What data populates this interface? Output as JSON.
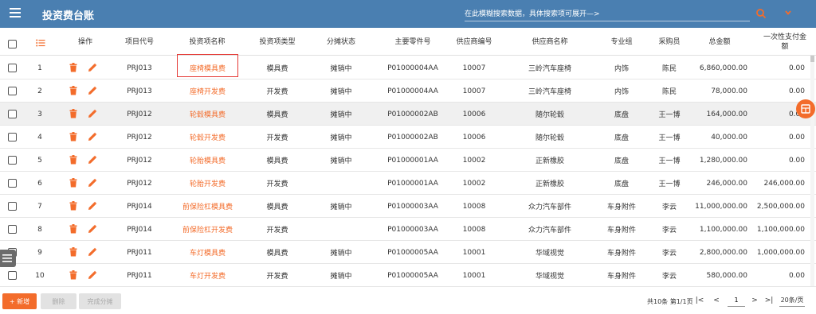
{
  "header": {
    "title": "投资费台账",
    "search_placeholder": "在此模糊搜索数据，具体搜索项可展开—>",
    "colors": {
      "bar": "#4a7fb1",
      "accent": "#f36c2b"
    },
    "icons": [
      "menu-icon",
      "search-icon",
      "chevron-down-icon"
    ]
  },
  "columns": {
    "operation": "操作",
    "project_code": "项目代号",
    "item_name": "投资项名称",
    "item_type": "投资项类型",
    "share_status": "分摊状态",
    "part_no": "主要零件号",
    "supplier_code": "供应商编号",
    "supplier_name": "供应商名称",
    "group": "专业组",
    "buyer": "采购员",
    "total": "总金额",
    "lump_sum": "一次性支付金额"
  },
  "rows": [
    {
      "no": "1",
      "project": "PRJ013",
      "name": "座椅模具费",
      "type": "模具费",
      "status": "摊销中",
      "part": "P01000004AA",
      "supplier_code": "10007",
      "supplier": "三岭汽车座椅",
      "group": "内饰",
      "buyer": "陈民",
      "total": "6,860,000.00",
      "lump": "0.00"
    },
    {
      "no": "2",
      "project": "PRJ013",
      "name": "座椅开发费",
      "type": "开发费",
      "status": "摊销中",
      "part": "P01000004AA",
      "supplier_code": "10007",
      "supplier": "三岭汽车座椅",
      "group": "内饰",
      "buyer": "陈民",
      "total": "78,000.00",
      "lump": "0.00"
    },
    {
      "no": "3",
      "project": "PRJ012",
      "name": "轮毂模具费",
      "type": "模具费",
      "status": "摊销中",
      "part": "P01000002AB",
      "supplier_code": "10006",
      "supplier": "随尔轮毂",
      "group": "底盘",
      "buyer": "王一博",
      "total": "164,000.00",
      "lump": "0.00"
    },
    {
      "no": "4",
      "project": "PRJ012",
      "name": "轮毂开发费",
      "type": "开发费",
      "status": "摊销中",
      "part": "P01000002AB",
      "supplier_code": "10006",
      "supplier": "随尔轮毂",
      "group": "底盘",
      "buyer": "王一博",
      "total": "40,000.00",
      "lump": "0.00"
    },
    {
      "no": "5",
      "project": "PRJ012",
      "name": "轮胎模具费",
      "type": "模具费",
      "status": "摊销中",
      "part": "P01000001AA",
      "supplier_code": "10002",
      "supplier": "正新橡胶",
      "group": "底盘",
      "buyer": "王一博",
      "total": "1,280,000.00",
      "lump": "0.00"
    },
    {
      "no": "6",
      "project": "PRJ012",
      "name": "轮胎开发费",
      "type": "开发费",
      "status": "",
      "part": "P01000001AA",
      "supplier_code": "10002",
      "supplier": "正新橡胶",
      "group": "底盘",
      "buyer": "王一博",
      "total": "246,000.00",
      "lump": "246,000.00"
    },
    {
      "no": "7",
      "project": "PRJ014",
      "name": "前保险杠模具费",
      "type": "模具费",
      "status": "摊销中",
      "part": "P01000003AA",
      "supplier_code": "10008",
      "supplier": "众力汽车部件",
      "group": "车身附件",
      "buyer": "李云",
      "total": "11,000,000.00",
      "lump": "2,500,000.00"
    },
    {
      "no": "8",
      "project": "PRJ014",
      "name": "前保险杠开发费",
      "type": "开发费",
      "status": "",
      "part": "P01000003AA",
      "supplier_code": "10008",
      "supplier": "众力汽车部件",
      "group": "车身附件",
      "buyer": "李云",
      "total": "1,100,000.00",
      "lump": "1,100,000.00"
    },
    {
      "no": "9",
      "project": "PRJ011",
      "name": "车灯模具费",
      "type": "模具费",
      "status": "摊销中",
      "part": "P01000005AA",
      "supplier_code": "10001",
      "supplier": "华域视觉",
      "group": "车身附件",
      "buyer": "李云",
      "total": "2,800,000.00",
      "lump": "1,000,000.00"
    },
    {
      "no": "10",
      "project": "PRJ011",
      "name": "车灯开发费",
      "type": "开发费",
      "status": "摊销中",
      "part": "P01000005AA",
      "supplier_code": "10001",
      "supplier": "华域视觉",
      "group": "车身附件",
      "buyer": "李云",
      "total": "580,000.00",
      "lump": "0.00"
    }
  ],
  "footer": {
    "new_label": "+ 新增",
    "delete_label": "删除",
    "complete_label": "完成分摊",
    "page_info": "共10条 第1/1页",
    "first": "|<",
    "prev": "<",
    "page": "1",
    "next": ">",
    "last": ">|",
    "page_size": "20条/页"
  }
}
